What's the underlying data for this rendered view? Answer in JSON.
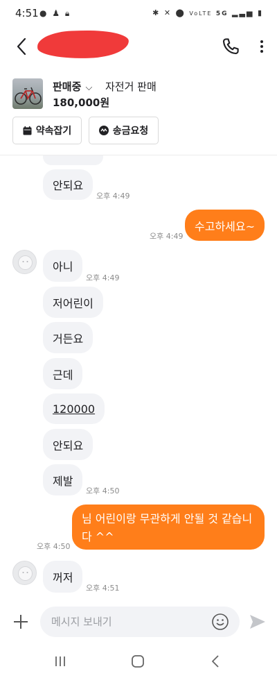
{
  "status_bar": {
    "time": "4:51",
    "left_icons": [
      "chat-notification-icon",
      "app-notification-icon",
      "lock-icon"
    ],
    "right_icons": [
      "bluetooth-icon",
      "mute-icon",
      "location-icon",
      "wifi-calling-icon",
      "5g-icon",
      "signal-icon",
      "battery-icon"
    ],
    "vowifi_text": "VoLTE",
    "network_text": "5G"
  },
  "header": {
    "back_icon": "chevron-left-icon",
    "name_redacted": true,
    "redaction_color": "#f03a3a",
    "call_icon": "phone-icon",
    "more_icon": "more-vertical-icon"
  },
  "product": {
    "thumbnail": "bicycle-photo",
    "status": "판매중",
    "title": "자전거 판매",
    "price": "180,000원",
    "appointment_label": "약속잡기",
    "remit_label": "송금요청"
  },
  "messages": [
    {
      "from": "other",
      "text": "",
      "time": ""
    },
    {
      "from": "other",
      "text": "안되요",
      "time": "오후 4:49"
    },
    {
      "from": "me",
      "text": "수고하세요~",
      "time": "오후 4:49"
    },
    {
      "from": "other",
      "text": "아니",
      "time": "오후 4:49",
      "avatar": true
    },
    {
      "from": "other",
      "text": "저어린이",
      "time": ""
    },
    {
      "from": "other",
      "text": "거든요",
      "time": ""
    },
    {
      "from": "other",
      "text": "근데",
      "time": ""
    },
    {
      "from": "other",
      "text": "120000",
      "time": "",
      "underlined": true
    },
    {
      "from": "other",
      "text": "안되요",
      "time": ""
    },
    {
      "from": "other",
      "text": "제발",
      "time": "오후 4:50"
    },
    {
      "from": "me",
      "text": "님 어린이랑 무관하게 안될 것 같습니다 ^^",
      "time": "오후 4:50"
    },
    {
      "from": "other",
      "text": "꺼저",
      "time": "오후 4:51",
      "avatar": true
    }
  ],
  "input": {
    "placeholder": "메시지 보내기",
    "value": ""
  },
  "colors": {
    "accent": "#ff7e1a",
    "bubble_other": "#f2f3f6",
    "time_text": "#8b8b8b"
  }
}
